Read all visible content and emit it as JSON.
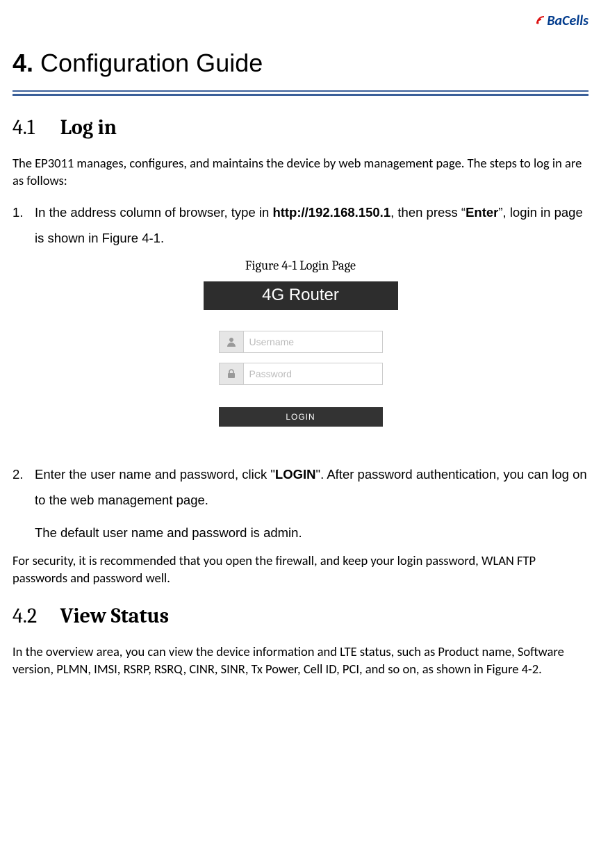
{
  "logo": {
    "text_ba": "Ba",
    "text_cells": "Cells",
    "brand_color": "#0a3d86"
  },
  "h1": {
    "num": "4.",
    "title": "Configuration Guide"
  },
  "sec41": {
    "num": "4.1",
    "title": "Log in",
    "intro": "The EP3011 manages, configures, and maintains the device by web management page. The steps to log in are as follows:",
    "step1_a": "In the address column of browser, type in ",
    "step1_url": "http://192.168.150.1",
    "step1_b": ", then press “",
    "step1_enter": "Enter",
    "step1_c": "”, login in page is shown in Figure 4-1.",
    "fig_caption": "Figure 4-1 Login Page",
    "login_header": "4G Router",
    "username_placeholder": "Username",
    "password_placeholder": "Password",
    "login_btn": "LOGIN",
    "step2_a": "Enter the user name and password, click \"",
    "step2_login": "LOGIN",
    "step2_b": "\". After password authentication, you can log on to the web management page.",
    "step2_c": "The default user name and password is admin.",
    "security_note": "For security, it is recommended that you open the firewall, and keep your login password, WLAN FTP passwords and password well."
  },
  "sec42": {
    "num": "4.2",
    "title": "View Status",
    "body": "In the overview area, you can view the device information and LTE status, such as Product name, Software version, PLMN, IMSI, RSRP, RSRQ, CINR, SINR, Tx Power, Cell ID, PCI, and so on, as shown in Figure 4-2."
  }
}
